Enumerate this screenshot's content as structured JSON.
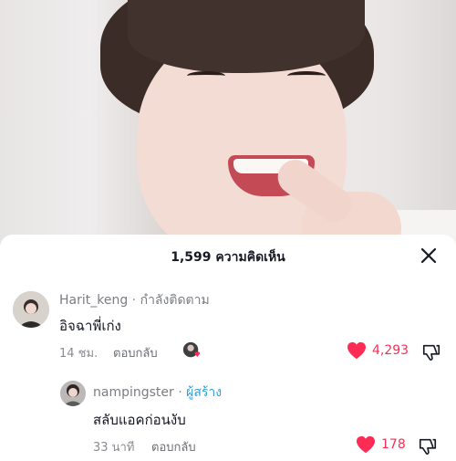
{
  "colors": {
    "accent": "#fe2c55",
    "creator": "#2f9fd8",
    "text": "#161823",
    "muted": "#8a8b91"
  },
  "sheet": {
    "title": "1,599 ความคิดเห็น"
  },
  "comments": [
    {
      "username": "Harit_keng",
      "separator": " · ",
      "tag": "กำลังติดตาม",
      "text": "อิจฉาพี่เก่ง",
      "time": "14 ชม.",
      "reply_label": "ตอบกลับ",
      "likes": "4,293",
      "liked": true,
      "creator_liked": true
    },
    {
      "username": "nampingster",
      "separator": " · ",
      "tag": "ผู้สร้าง",
      "text": "สลับแอคก่อนงับ",
      "time": "33 นาที",
      "reply_label": "ตอบกลับ",
      "likes": "178",
      "liked": true
    }
  ],
  "icons": {
    "close": "close-icon",
    "heart": "heart-icon",
    "dislike": "thumbs-down-icon"
  }
}
